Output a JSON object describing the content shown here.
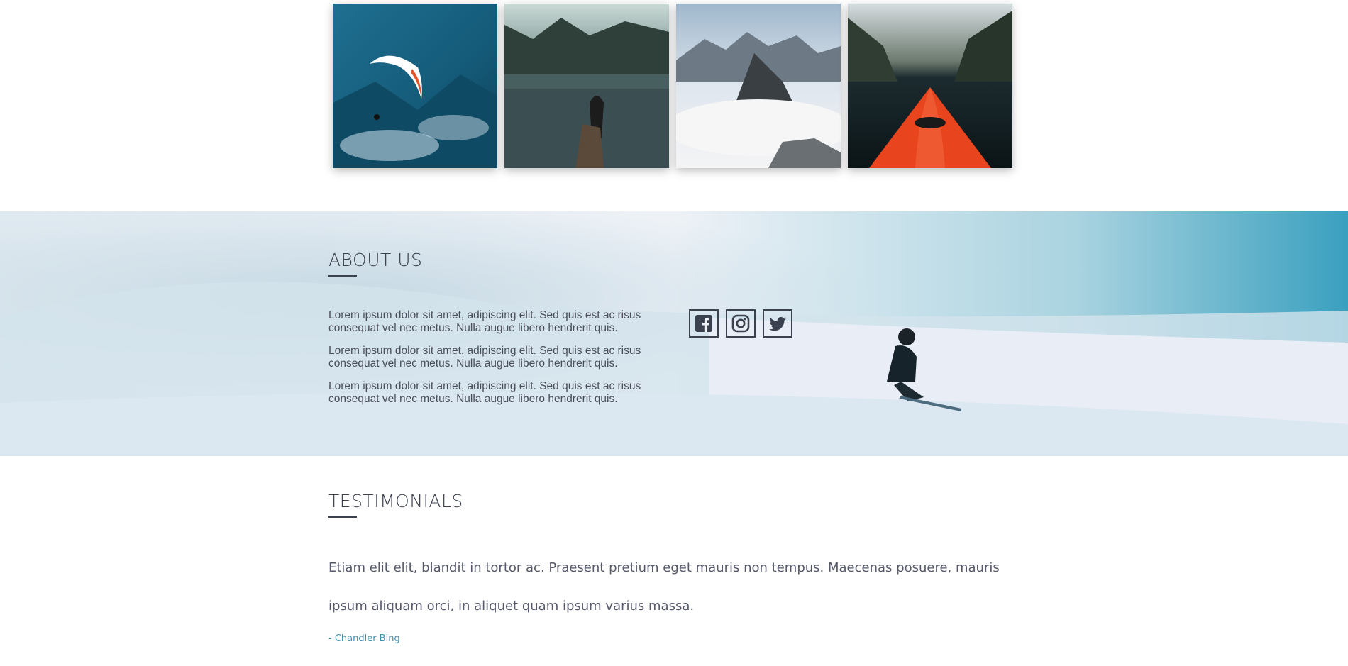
{
  "gallery": {
    "photos": [
      {
        "icon": "paraglider-photo"
      },
      {
        "icon": "lake-hiker-photo"
      },
      {
        "icon": "mountain-peaks-photo"
      },
      {
        "icon": "kayak-fjord-photo"
      }
    ]
  },
  "about": {
    "title": "ABOUT US",
    "paragraphs": [
      "Lorem ipsum dolor sit amet, adipiscing elit. Sed quis est ac risus consequat vel nec metus. Nulla augue libero hendrerit quis.",
      "Lorem ipsum dolor sit amet, adipiscing elit. Sed quis est ac risus consequat vel nec metus. Nulla augue libero hendrerit quis.",
      "Lorem ipsum dolor sit amet, adipiscing elit. Sed quis est ac risus consequat vel nec metus. Nulla augue libero hendrerit quis."
    ],
    "socials": [
      {
        "icon": "facebook-icon"
      },
      {
        "icon": "instagram-icon"
      },
      {
        "icon": "twitter-icon"
      }
    ]
  },
  "testimonials": {
    "title": "TESTIMONIALS",
    "quote": "Etiam elit elit, blandit in tortor ac. Praesent pretium eget mauris non tempus. Maecenas posuere, mauris ipsum aliquam orci, in aliquet quam ipsum varius massa.",
    "author": "- Chandler Bing"
  },
  "colors": {
    "heading": "#3c4150",
    "body_text": "#4a4e5c",
    "author_link": "#3d8fb0"
  }
}
